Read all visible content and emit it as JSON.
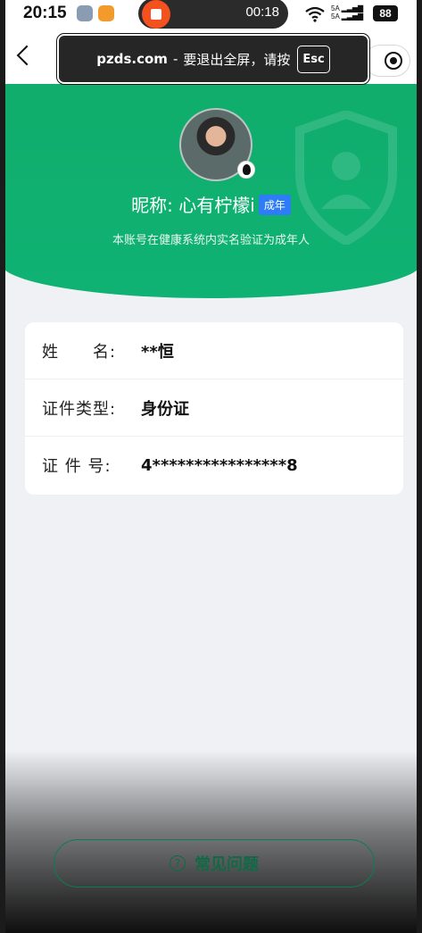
{
  "status_bar": {
    "time": "20:15",
    "recording_time": "00:18",
    "wifi_icon": "wifi-icon",
    "signal_top": "5A",
    "signal_bottom": "5A",
    "battery": "88"
  },
  "overlay": {
    "domain": "pzds.com",
    "separator": "-",
    "message": "要退出全屏，请按",
    "key": "Esc"
  },
  "profile": {
    "nickname_label": "昵称: ",
    "nickname": "心有柠檬i",
    "badge": "成年",
    "subtitle": "本账号在健康系统内实名验证为成年人"
  },
  "info": {
    "rows": [
      {
        "label": "姓　　名:",
        "value": "**恒"
      },
      {
        "label": "证件类型:",
        "value": "身份证"
      },
      {
        "label": "证 件 号:",
        "value": "4****************8"
      }
    ]
  },
  "footer": {
    "help_icon_glyph": "?",
    "faq_label": "常见问题"
  },
  "colors": {
    "accent_green": "#10ad6c",
    "badge_blue": "#2e7cf6"
  }
}
